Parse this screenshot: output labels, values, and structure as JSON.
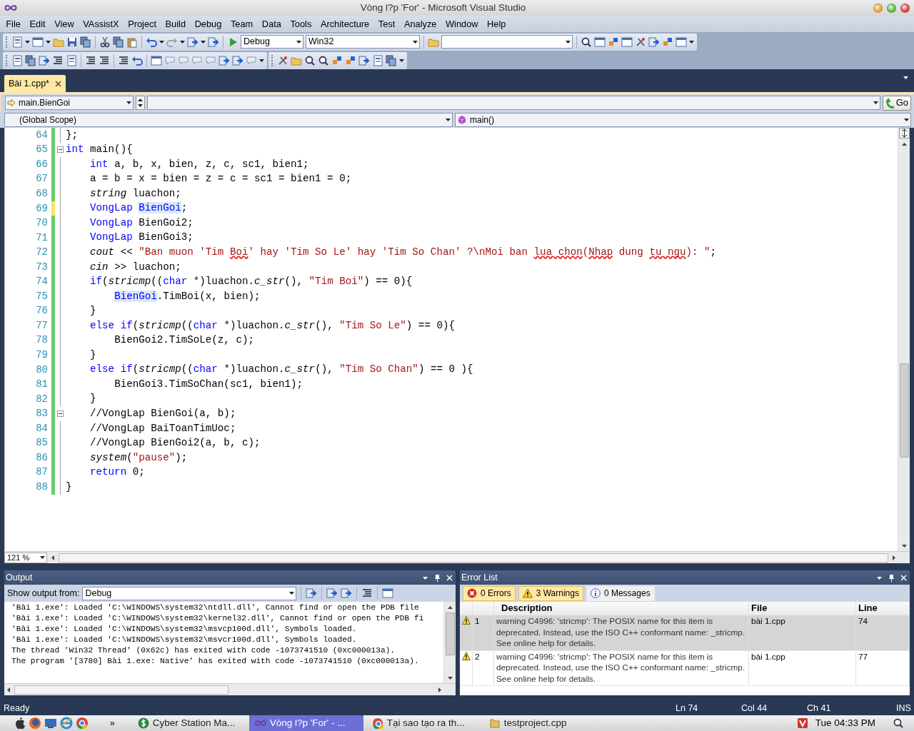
{
  "window": {
    "title": "Vòng l?p 'For' - Microsoft Visual Studio"
  },
  "menu": [
    "File",
    "Edit",
    "View",
    "VAssistX",
    "Project",
    "Build",
    "Debug",
    "Team",
    "Data",
    "Tools",
    "Architecture",
    "Test",
    "Analyze",
    "Window",
    "Help"
  ],
  "toolbar": {
    "configuration": "Debug",
    "platform": "Win32"
  },
  "document_tabs": [
    {
      "label": "Bài 1.cpp*",
      "selected": true
    }
  ],
  "navigation": {
    "member": "main.BienGoi",
    "go_button": "Go",
    "scope": "(Global Scope)",
    "function": "main()"
  },
  "editor": {
    "zoom": "121 %",
    "lines": [
      {
        "number": "64",
        "unsaved": false,
        "fold": false,
        "tokens": [
          {
            "kind": "plain",
            "text": "};"
          }
        ]
      },
      {
        "number": "65",
        "unsaved": false,
        "fold": true,
        "tokens": [
          {
            "kind": "keyword",
            "text": "int"
          },
          {
            "kind": "plain",
            "text": " main(){"
          }
        ]
      },
      {
        "number": "66",
        "unsaved": false,
        "fold": false,
        "tokens": [
          {
            "kind": "keyword",
            "text": "    int"
          },
          {
            "kind": "plain",
            "text": " a, b, x, bien, z, c, sc1, bien1;"
          }
        ]
      },
      {
        "number": "67",
        "unsaved": false,
        "fold": false,
        "tokens": [
          {
            "kind": "plain",
            "text": "    a = b = x = bien = z = c = sc1 = bien1 = 0;"
          }
        ]
      },
      {
        "number": "68",
        "unsaved": false,
        "fold": false,
        "tokens": [
          {
            "kind": "italic",
            "text": "    string"
          },
          {
            "kind": "plain",
            "text": " luachon;"
          }
        ]
      },
      {
        "number": "69",
        "unsaved": true,
        "fold": false,
        "tokens": [
          {
            "kind": "keyword",
            "text": "    VongLap"
          },
          {
            "kind": "reference",
            "text": " BienGoi"
          },
          {
            "kind": "plain",
            "text": ";"
          }
        ]
      },
      {
        "number": "70",
        "unsaved": false,
        "fold": false,
        "tokens": [
          {
            "kind": "keyword",
            "text": "    VongLap"
          },
          {
            "kind": "plain",
            "text": " BienGoi2;"
          }
        ]
      },
      {
        "number": "71",
        "unsaved": false,
        "fold": false,
        "tokens": [
          {
            "kind": "keyword",
            "text": "    VongLap"
          },
          {
            "kind": "plain",
            "text": " BienGoi3;"
          }
        ]
      },
      {
        "number": "72",
        "unsaved": false,
        "fold": false,
        "tokens": [
          {
            "kind": "italic",
            "text": "    cout"
          },
          {
            "kind": "plain",
            "text": " << "
          },
          {
            "kind": "string",
            "text": "\"Ban muon 'Tim "
          },
          {
            "kind": "misspelled",
            "text": "Boi"
          },
          {
            "kind": "string",
            "text": "' hay 'Tim So Le' hay 'Tim So Chan' ?\\nMoi ban "
          },
          {
            "kind": "misspelled",
            "text": "lua chon"
          },
          {
            "kind": "string",
            "text": "("
          },
          {
            "kind": "misspelled",
            "text": "Nhap"
          },
          {
            "kind": "string",
            "text": " dung "
          },
          {
            "kind": "misspelled",
            "text": "tu ngu"
          },
          {
            "kind": "string",
            "text": "): \""
          },
          {
            "kind": "plain",
            "text": ";"
          }
        ]
      },
      {
        "number": "73",
        "unsaved": false,
        "fold": false,
        "tokens": [
          {
            "kind": "italic",
            "text": "    cin"
          },
          {
            "kind": "plain",
            "text": " >> luachon;"
          }
        ]
      },
      {
        "number": "74",
        "unsaved": false,
        "fold": false,
        "tokens": [
          {
            "kind": "keyword",
            "text": "    if"
          },
          {
            "kind": "plain",
            "text": "("
          },
          {
            "kind": "italic",
            "text": "stricmp"
          },
          {
            "kind": "plain",
            "text": "(("
          },
          {
            "kind": "keyword",
            "text": "char"
          },
          {
            "kind": "plain",
            "text": " *)luachon."
          },
          {
            "kind": "italic",
            "text": "c_str"
          },
          {
            "kind": "plain",
            "text": "(), "
          },
          {
            "kind": "string",
            "text": "\"Tim Boi\""
          },
          {
            "kind": "plain",
            "text": ") == 0){"
          }
        ]
      },
      {
        "number": "75",
        "unsaved": false,
        "fold": false,
        "tokens": [
          {
            "kind": "reference",
            "text": "        BienGoi"
          },
          {
            "kind": "plain",
            "text": ".TimBoi(x, bien);"
          }
        ]
      },
      {
        "number": "76",
        "unsaved": false,
        "fold": false,
        "tokens": [
          {
            "kind": "plain",
            "text": "    }"
          }
        ]
      },
      {
        "number": "77",
        "unsaved": false,
        "fold": false,
        "tokens": [
          {
            "kind": "keyword",
            "text": "    else if"
          },
          {
            "kind": "plain",
            "text": "("
          },
          {
            "kind": "italic",
            "text": "stricmp"
          },
          {
            "kind": "plain",
            "text": "(("
          },
          {
            "kind": "keyword",
            "text": "char"
          },
          {
            "kind": "plain",
            "text": " *)luachon."
          },
          {
            "kind": "italic",
            "text": "c_str"
          },
          {
            "kind": "plain",
            "text": "(), "
          },
          {
            "kind": "string",
            "text": "\"Tim So Le\""
          },
          {
            "kind": "plain",
            "text": ") == 0){"
          }
        ]
      },
      {
        "number": "78",
        "unsaved": false,
        "fold": false,
        "tokens": [
          {
            "kind": "plain",
            "text": "        BienGoi2.TimSoLe(z, c);"
          }
        ]
      },
      {
        "number": "79",
        "unsaved": false,
        "fold": false,
        "tokens": [
          {
            "kind": "plain",
            "text": "    }"
          }
        ]
      },
      {
        "number": "80",
        "unsaved": false,
        "fold": false,
        "tokens": [
          {
            "kind": "keyword",
            "text": "    else if"
          },
          {
            "kind": "plain",
            "text": "("
          },
          {
            "kind": "italic",
            "text": "stricmp"
          },
          {
            "kind": "plain",
            "text": "(("
          },
          {
            "kind": "keyword",
            "text": "char"
          },
          {
            "kind": "plain",
            "text": " *)luachon."
          },
          {
            "kind": "italic",
            "text": "c_str"
          },
          {
            "kind": "plain",
            "text": "(), "
          },
          {
            "kind": "string",
            "text": "\"Tim So Chan\""
          },
          {
            "kind": "plain",
            "text": ") == 0 ){"
          }
        ]
      },
      {
        "number": "81",
        "unsaved": false,
        "fold": false,
        "tokens": [
          {
            "kind": "plain",
            "text": "        BienGoi3.TimSoChan(sc1, bien1);"
          }
        ]
      },
      {
        "number": "82",
        "unsaved": false,
        "fold": false,
        "tokens": [
          {
            "kind": "plain",
            "text": "    }"
          }
        ]
      },
      {
        "number": "83",
        "unsaved": false,
        "fold": true,
        "tokens": [
          {
            "kind": "plain",
            "text": "    //VongLap BienGoi(a, b);"
          }
        ]
      },
      {
        "number": "84",
        "unsaved": false,
        "fold": false,
        "tokens": [
          {
            "kind": "plain",
            "text": "    //VongLap BaiToanTimUoc;"
          }
        ]
      },
      {
        "number": "85",
        "unsaved": false,
        "fold": false,
        "tokens": [
          {
            "kind": "plain",
            "text": "    //VongLap BienGoi2(a, b, c);"
          }
        ]
      },
      {
        "number": "86",
        "unsaved": false,
        "fold": false,
        "tokens": [
          {
            "kind": "italic",
            "text": "    system"
          },
          {
            "kind": "plain",
            "text": "("
          },
          {
            "kind": "string",
            "text": "\"pause\""
          },
          {
            "kind": "plain",
            "text": ");"
          }
        ]
      },
      {
        "number": "87",
        "unsaved": false,
        "fold": false,
        "tokens": [
          {
            "kind": "keyword",
            "text": "    return"
          },
          {
            "kind": "plain",
            "text": " 0;"
          }
        ]
      },
      {
        "number": "88",
        "unsaved": false,
        "fold": false,
        "tokens": [
          {
            "kind": "plain",
            "text": "}"
          }
        ]
      }
    ]
  },
  "output": {
    "title": "Output",
    "source_label": "Show output from:",
    "source": "Debug",
    "lines": [
      "'Bài 1.exe': Loaded 'C:\\WINDOWS\\system32\\ntdll.dll', Cannot find or open the PDB file",
      "'Bài 1.exe': Loaded 'C:\\WINDOWS\\system32\\kernel32.dll', Cannot find or open the PDB fi",
      "'Bài 1.exe': Loaded 'C:\\WINDOWS\\system32\\msvcp100d.dll', Symbols loaded.",
      "'Bài 1.exe': Loaded 'C:\\WINDOWS\\system32\\msvcr100d.dll', Symbols loaded.",
      "The thread 'Win32 Thread' (0x62c) has exited with code -1073741510 (0xc000013a).",
      "The program '[3780] Bài 1.exe: Native' has exited with code -1073741510 (0xc000013a)."
    ]
  },
  "error_list": {
    "title": "Error List",
    "filters": [
      {
        "kind": "error",
        "label": "0 Errors",
        "on": true
      },
      {
        "kind": "warning",
        "label": "3 Warnings",
        "on": true
      },
      {
        "kind": "message",
        "label": "0 Messages",
        "on": false
      }
    ],
    "columns": [
      "Description",
      "File",
      "Line"
    ],
    "rows": [
      {
        "number": "1",
        "description": "warning C4996: 'stricmp': The POSIX name for this item is deprecated. Instead, use the ISO C++ conformant name: _stricmp. See online help for details.",
        "file": "bài 1.cpp",
        "line": "74",
        "selected": true
      },
      {
        "number": "2",
        "description": "warning C4996: 'stricmp': The POSIX name for this item is deprecated. Instead, use the ISO C++ conformant name: _stricmp. See online help for details.",
        "file": "bài 1.cpp",
        "line": "77",
        "selected": false
      }
    ]
  },
  "status_bar": {
    "message": "Ready",
    "line": "Ln 74",
    "column": "Col 44",
    "character": "Ch 41",
    "mode": "INS"
  },
  "taskbar": {
    "overflow": "»",
    "tasks": [
      {
        "kind": "money",
        "label": "Cyber Station Ma...",
        "selected": false
      },
      {
        "kind": "studio",
        "label": "Vòng l?p 'For' - ...",
        "selected": true
      },
      {
        "kind": "browser",
        "label": "Tại sao tạo ra th...",
        "selected": false
      },
      {
        "kind": "folder",
        "label": "testproject.cpp",
        "selected": false
      }
    ],
    "clock": "Tue 04:33 PM"
  }
}
